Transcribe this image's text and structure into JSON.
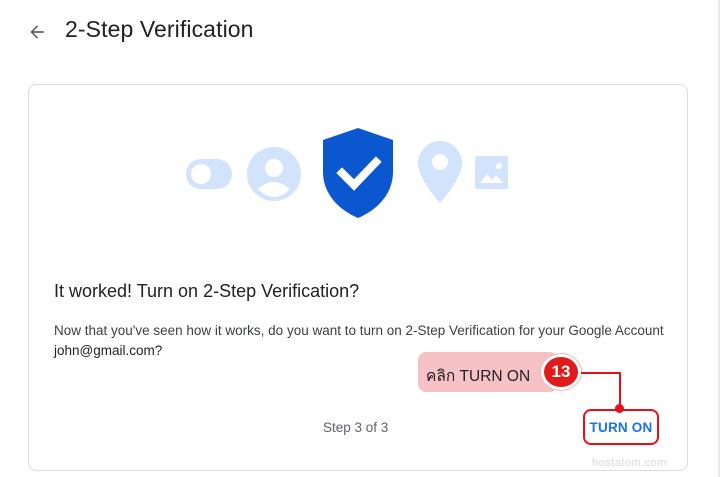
{
  "header": {
    "back_icon": "arrow-left-icon",
    "title": "2-Step Verification"
  },
  "card": {
    "illustration_icons": [
      "toggle-icon",
      "account-icon",
      "shield-check-icon",
      "location-pin-icon",
      "image-icon"
    ],
    "heading": "It worked! Turn on 2-Step Verification?",
    "description": "Now that you've seen how it works, do you want to turn on 2-Step Verification for your Google Account",
    "email": "john@gmail.com?",
    "step": "Step 3 of 3",
    "turn_on_label": "TURN ON"
  },
  "annotation": {
    "callout_text": "คลิก TURN ON",
    "step_number": "13"
  },
  "watermark": "hostatom.com",
  "colors": {
    "accent_blue": "#1a73e8",
    "shield_blue": "#0b57d0",
    "light_blue": "#d2e3fc",
    "annotation_red": "#e5101a",
    "callout_pink": "#f7c2c5"
  }
}
